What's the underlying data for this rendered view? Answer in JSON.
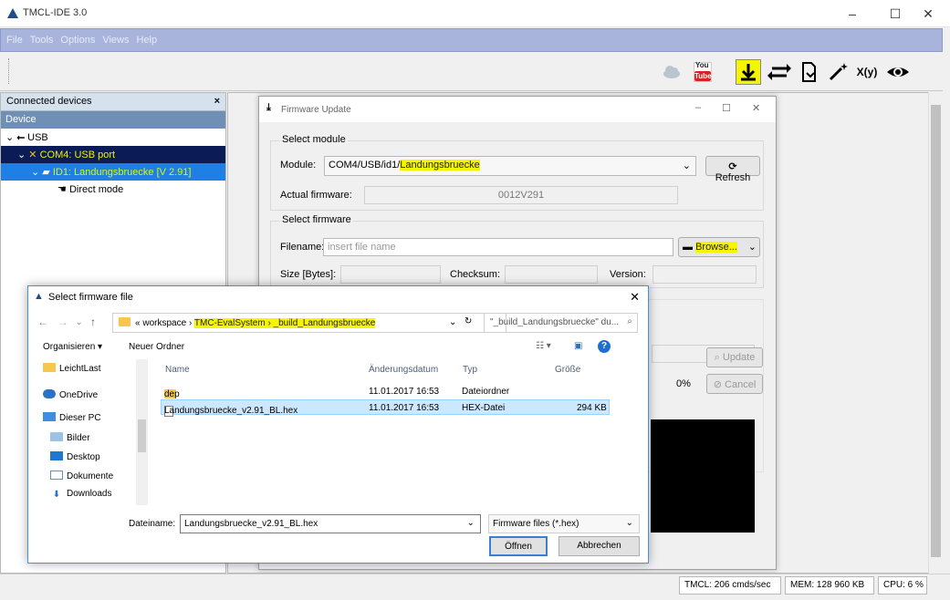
{
  "window": {
    "title": "TMCL-IDE 3.0"
  },
  "menu": [
    "File",
    "Tools",
    "Options",
    "Views",
    "Help"
  ],
  "toolbar": {
    "icons": [
      "cloud-icon",
      "youtube-icon",
      "download-firmware-icon",
      "exchange-icon",
      "export-icon",
      "wizard-icon",
      "function-icon",
      "eye-icon"
    ],
    "youtube_top": "You",
    "youtube_bottom": "Tube",
    "function_label": "X(y)"
  },
  "devices_panel": {
    "header": "Connected devices",
    "close": "×",
    "column": "Device",
    "tree": {
      "usb": "USB",
      "com": "COM4: USB port",
      "module_prefix": "ID1: ",
      "module_name": "Landungsbruecke",
      "module_version": "[V 2.91]",
      "mode": "Direct mode"
    }
  },
  "firmware_update": {
    "title": "Firmware Update",
    "select_module": "Select module",
    "module_label": "Module:",
    "module_value_prefix": "COM4/USB/id1/",
    "module_value_name": "Landungsbruecke",
    "refresh": "Refresh",
    "actual_firmware_label": "Actual firmware:",
    "actual_firmware_value": "0012V291",
    "select_firmware": "Select firmware",
    "filename_label": "Filename:",
    "filename_placeholder": "insert file name",
    "browse": "Browse...",
    "size_label": "Size [Bytes]:",
    "checksum_label": "Checksum:",
    "version_label": "Version:",
    "update": "Update",
    "progress": "0%",
    "cancel": "Cancel"
  },
  "file_dialog": {
    "title": "Select firmware file",
    "path_prefix": "«",
    "path": [
      "workspace",
      "TMC-EvalSystem",
      "_build_Landungsbruecke"
    ],
    "search_placeholder": "\"_build_Landungsbruecke\" du...",
    "organize": "Organisieren ▾",
    "new_folder": "Neuer Ordner",
    "nav_items": [
      {
        "label": "LeichtLast",
        "icon": "folder-icon"
      },
      {
        "label": "OneDrive",
        "icon": "cloud-icon"
      },
      {
        "label": "Dieser PC",
        "icon": "computer-icon"
      },
      {
        "label": "Bilder",
        "icon": "pictures-icon"
      },
      {
        "label": "Desktop",
        "icon": "desktop-icon"
      },
      {
        "label": "Dokumente",
        "icon": "documents-icon"
      },
      {
        "label": "Downloads",
        "icon": "downloads-icon"
      }
    ],
    "columns": [
      "Name",
      "Änderungsdatum",
      "Typ",
      "Größe"
    ],
    "files": [
      {
        "name": "dep",
        "date": "11.01.2017 16:53",
        "type": "Dateiordner",
        "size": ""
      },
      {
        "name": "Landungsbruecke_v2.91_BL.hex",
        "date": "11.01.2017 16:53",
        "type": "HEX-Datei",
        "size": "294 KB"
      }
    ],
    "filename_label": "Dateiname:",
    "filename_value": "Landungsbruecke_v2.91_BL.hex",
    "filetype": "Firmware files (*.hex)",
    "open": "Öffnen",
    "cancel": "Abbrechen"
  },
  "status": {
    "tmcl": "TMCL: 206 cmds/sec",
    "mem": "MEM: 128 960 KB",
    "cpu": "CPU: 6 %"
  },
  "colors": {
    "menubar": "#a8b4dc",
    "highlight": "#f5f500",
    "tree_selected": "#1e7fe5",
    "tree_com": "#0a1b56"
  }
}
